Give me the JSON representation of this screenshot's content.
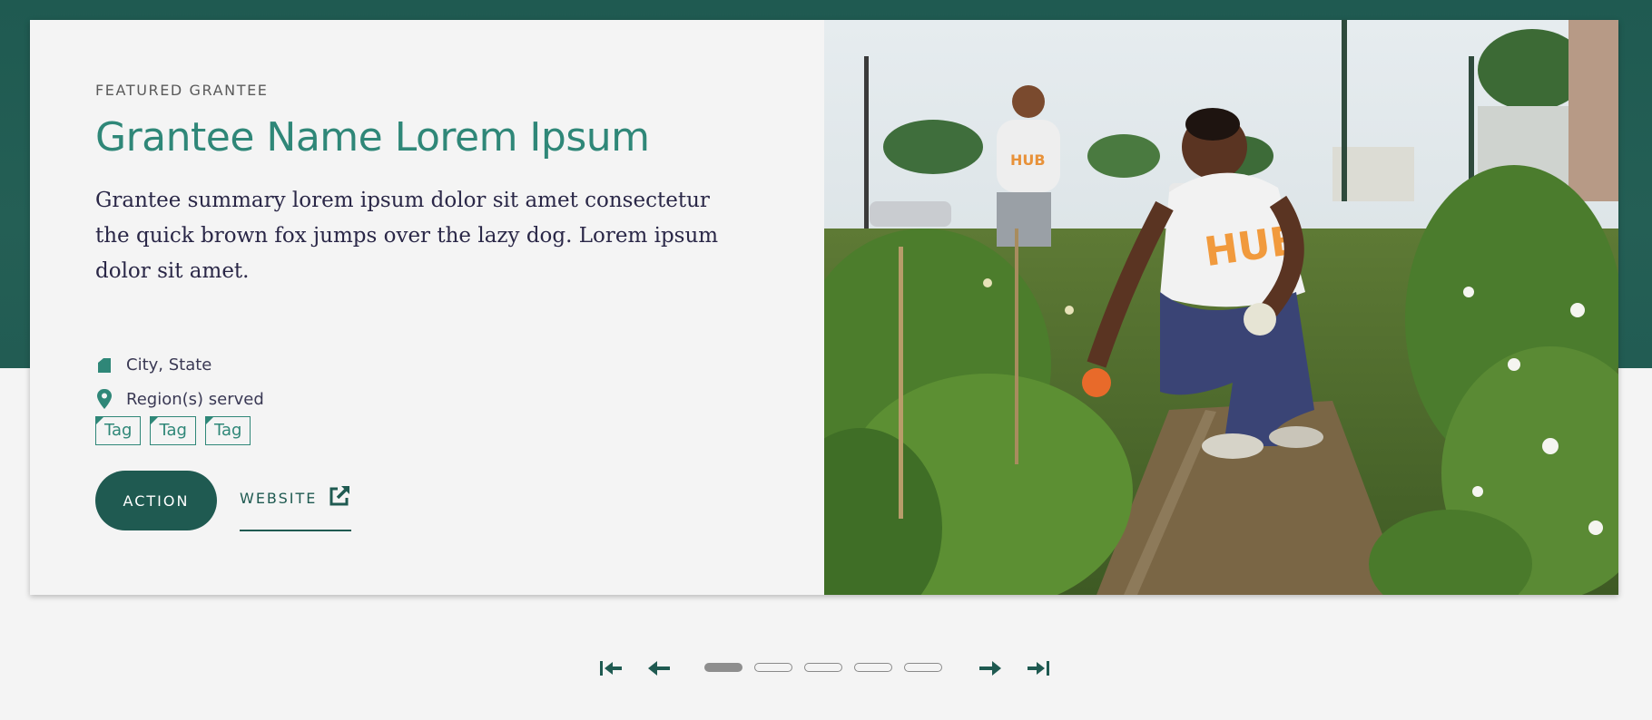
{
  "feature": {
    "eyebrow": "FEATURED GRANTEE",
    "title": "Grantee Name Lorem Ipsum",
    "summary": "Grantee summary lorem ipsum dolor sit amet consectetur the quick brown fox jumps over the lazy dog. Lorem ipsum dolor sit amet.",
    "location": {
      "icon": "building-icon",
      "text": "City, State"
    },
    "region": {
      "icon": "map-pin-icon",
      "text": "Region(s) served"
    },
    "tags": [
      "Tag",
      "Tag",
      "Tag"
    ],
    "action_label": "ACTION",
    "website_label": "WEBSITE",
    "website_icon": "external-link-icon",
    "photo_shirt_text": "HUB"
  },
  "pagination": {
    "first_icon": "first-page-icon",
    "prev_icon": "arrow-left-icon",
    "next_icon": "arrow-right-icon",
    "last_icon": "last-page-icon",
    "slide_count": 5,
    "active_slide": 1
  },
  "colors": {
    "band": "#1f5a51",
    "accent": "#2f8778",
    "text": "#2a2747",
    "background": "#f4f4f4"
  }
}
